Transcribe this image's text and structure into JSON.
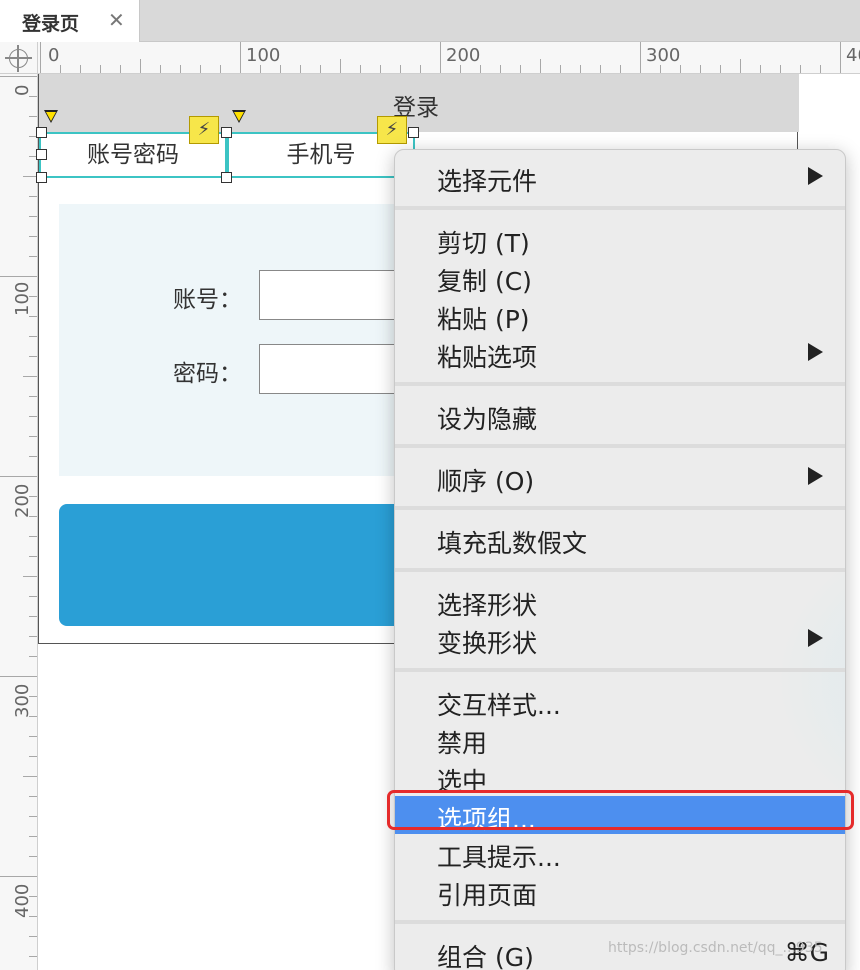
{
  "tab": {
    "label": "登录页",
    "close_glyph": "✕"
  },
  "ruler": {
    "h_labels": [
      "0",
      "100",
      "200",
      "300",
      "40"
    ],
    "v_labels": [
      "0",
      "100",
      "200",
      "300",
      "400"
    ]
  },
  "page": {
    "title": "登录",
    "tabs": [
      "账号密码",
      "手机号"
    ],
    "form": {
      "account_label": "账号：",
      "password_label": "密码："
    }
  },
  "context_menu": {
    "items": [
      {
        "label": "选择元件",
        "submenu": true
      },
      {
        "label": "剪切 (T)"
      },
      {
        "label": "复制 (C)"
      },
      {
        "label": "粘贴 (P)"
      },
      {
        "label": "粘贴选项",
        "submenu": true
      },
      {
        "label": "设为隐藏"
      },
      {
        "label": "顺序 (O)",
        "submenu": true
      },
      {
        "label": "填充乱数假文"
      },
      {
        "label": "选择形状"
      },
      {
        "label": "变换形状",
        "submenu": true
      },
      {
        "label": "交互样式..."
      },
      {
        "label": "禁用"
      },
      {
        "label": "选中"
      },
      {
        "label": "选项组...",
        "active": true
      },
      {
        "label": "工具提示..."
      },
      {
        "label": "引用页面"
      },
      {
        "label": "组合 (G)",
        "shortcut": "⌘G"
      }
    ]
  },
  "watermark": "https://blog.csdn.net/qq_...935",
  "colors": {
    "accent_blue": "#2a9fd6",
    "menu_active": "#4d8fef",
    "highlight_red": "#e52b2b",
    "selection_cyan": "#3cc4c4"
  }
}
